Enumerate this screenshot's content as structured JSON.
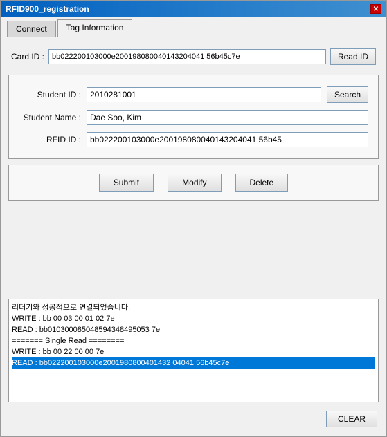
{
  "window": {
    "title": "RFID900_registration",
    "close_label": "✕"
  },
  "tabs": [
    {
      "id": "connect",
      "label": "Connect",
      "active": false
    },
    {
      "id": "tag-information",
      "label": "Tag Information",
      "active": true
    }
  ],
  "card_id": {
    "label": "Card ID :",
    "value": "bb022200103000e200198080040143204041 56b45c7e",
    "read_id_btn": "Read ID"
  },
  "student_fields": {
    "student_id_label": "Student ID :",
    "student_id_value": "2010281001",
    "search_btn": "Search",
    "student_name_label": "Student Name :",
    "student_name_value": "Dae Soo, Kim",
    "rfid_id_label": "RFID ID :",
    "rfid_id_value": "bb022200103000e200198080040143204041 56b45"
  },
  "action_buttons": {
    "submit": "Submit",
    "modify": "Modify",
    "delete": "Delete"
  },
  "log": {
    "lines": [
      {
        "text": "리더기와 성공적으로 연결되었습니다.",
        "highlighted": false
      },
      {
        "text": "WRITE : bb 00 03 00 01 02 7e",
        "highlighted": false
      },
      {
        "text": "READ  : bb010300085048594348495053 7e",
        "highlighted": false
      },
      {
        "text": "======= Single Read ========",
        "highlighted": false
      },
      {
        "text": "WRITE : bb 00 22 00 00 7e",
        "highlighted": false
      },
      {
        "text": "READ : bb022200103000e2001980800401432 04041 56b45c7e",
        "highlighted": true
      }
    ],
    "clear_btn": "CLEAR"
  }
}
